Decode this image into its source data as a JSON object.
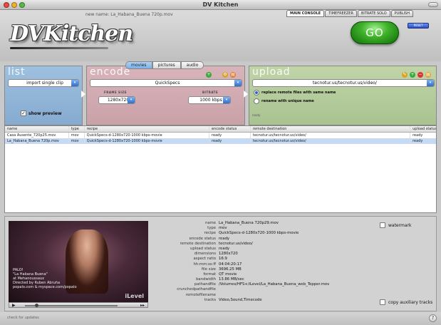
{
  "window": {
    "title": "DV Kitchen"
  },
  "header": {
    "file_name": "new name: La_Habana_Buena 720p.mov",
    "logo": "DVKitchen",
    "tabs": [
      "MAIN CONSOLE",
      "TIMEFREEZER",
      "BITRATE SOLO",
      "PUBLISH"
    ],
    "go_label": "GO",
    "small_button": "RESET"
  },
  "mode_tabs": [
    "movies",
    "pictures",
    "audio"
  ],
  "list_panel": {
    "title": "list",
    "select": "import single clip",
    "show_preview": "show preview"
  },
  "encode_panel": {
    "title": "encode",
    "preset": "QuickSpecs",
    "frame_size_label": "FRAME SIZE",
    "frame_size": "1280x720",
    "bitrate_label": "BITRATE",
    "bitrate": "1000 kbps"
  },
  "upload_panel": {
    "title": "upload",
    "destination": "tecnotur.us/tecnotur.us/video/",
    "option_replace": "replace remote files with same name",
    "option_rename": "rename with unique name",
    "status": "ready"
  },
  "table": {
    "headers": [
      "name",
      "type",
      "recipe",
      "encode status",
      "remote destination",
      "upload status"
    ],
    "rows": [
      [
        "Casa Ausente_720p25.mov",
        "mov",
        "QuickSpecs-d-1280x720-1000 kbps-movie",
        "ready",
        "tecnotur.us/tecnotur.us/video/",
        "ready"
      ],
      [
        "La_Habana_Buena 720p.mov",
        "mov",
        "QuickSpecs-d-1280x720-1000 kbps-movie",
        "ready",
        "tecnotur.us/tecnotur.us/video/",
        "ready"
      ]
    ]
  },
  "preview": {
    "caption_lines": [
      "PALO!",
      "\"La Habana Buena\"",
      "at Mehanoussaux",
      "Directed by Ruben Abruña",
      "popalo.com & myspace.com/popalo"
    ],
    "watermark": "iLevel"
  },
  "details": {
    "rows": [
      [
        "name",
        "La_Habana_Buena 720p29.mov"
      ],
      [
        "type",
        "mov"
      ],
      [
        "recipe",
        "QuickSpecs-d-1280x720-1000 kbps-movie"
      ],
      [
        "encode status",
        "ready"
      ],
      [
        "remote destination",
        "tecnotur.us/video/"
      ],
      [
        "upload status",
        "ready"
      ],
      [
        "dimensions",
        "1280x720"
      ],
      [
        "aspect ratio",
        "16:9"
      ],
      [
        "hh:mm:ss:ff",
        "04:04:20:17"
      ],
      [
        "file size",
        "3696.25 MB"
      ],
      [
        "format",
        "QT movie"
      ],
      [
        "bandwidth",
        "13.86 MB/sec"
      ],
      [
        "pathandfile",
        "/Volumes/HFS+/iLevel/La_Habana_Buena_web_Tepper.mov"
      ],
      [
        "crunchedpathandfile",
        ""
      ],
      [
        "remotefilename",
        ""
      ],
      [
        "tracks",
        "Video,Sound,Timecode"
      ]
    ],
    "watermark_label": "watermark",
    "copy_aux_label": "copy auxiliary tracks"
  },
  "status_bar": {
    "text": "check for updates",
    "help": "?"
  }
}
